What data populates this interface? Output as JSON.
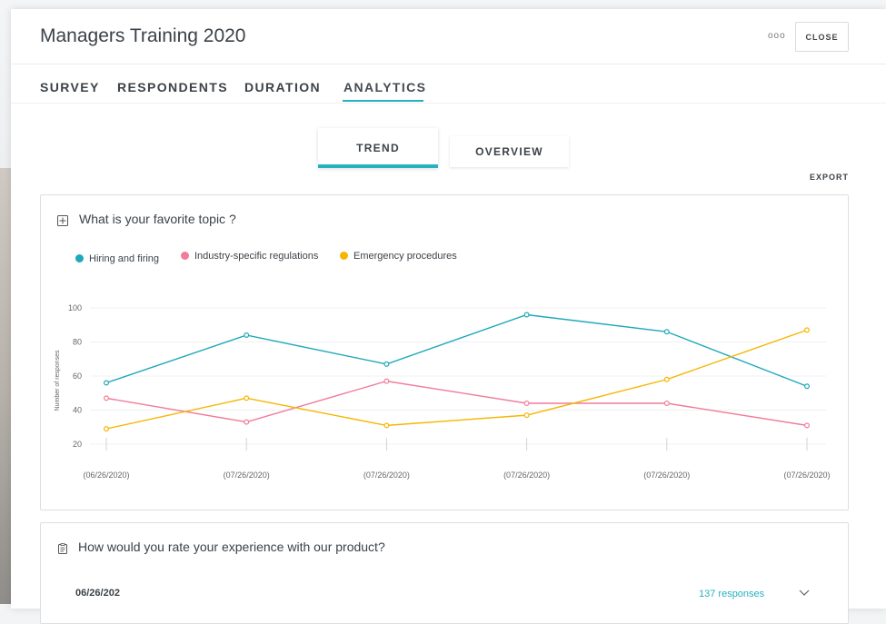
{
  "window": {
    "title": "Managers Training 2020",
    "more_label": "ooo",
    "close_label": "CLOSE"
  },
  "tabs": [
    {
      "label": "SURVEY"
    },
    {
      "label": "RESPONDENTS"
    },
    {
      "label": "DURATION"
    },
    {
      "label": "ANALYTICS",
      "active": true
    }
  ],
  "view_toggle": {
    "trend_label": "TREND",
    "overview_label": "OVERVIEW",
    "active": "TREND"
  },
  "export_label": "EXPORT",
  "colors": {
    "accent": "#27b1c0",
    "series1": "#1fa8bb",
    "series2": "#f07c9a",
    "series3": "#f7b500"
  },
  "question1": {
    "icon": "grid-icon",
    "text": "What is your favorite topic ?"
  },
  "chart_data": {
    "type": "line",
    "x": [
      "(06/26/2020)",
      "(07/26/2020)",
      "(07/26/2020)",
      "(07/26/2020)",
      "(07/26/2020)",
      "(07/26/2020)"
    ],
    "series": [
      {
        "name": "Hiring and firing",
        "values": [
          56,
          84,
          67,
          96,
          86,
          54
        ]
      },
      {
        "name": "Industry-specific regulations",
        "values": [
          47,
          33,
          57,
          44,
          44,
          31
        ]
      },
      {
        "name": "Emergency procedures",
        "values": [
          29,
          47,
          31,
          37,
          58,
          87
        ]
      }
    ],
    "ylabel": "Number of responses",
    "yticks": [
      20,
      40,
      60,
      80,
      100
    ],
    "ylim": [
      20,
      100
    ],
    "legend_position": "top-left",
    "grid": true
  },
  "question2": {
    "icon": "clipboard-icon",
    "text": "How would you rate your experience with our product?",
    "row": {
      "date": "06/26/202",
      "responses": "137 responses"
    }
  }
}
